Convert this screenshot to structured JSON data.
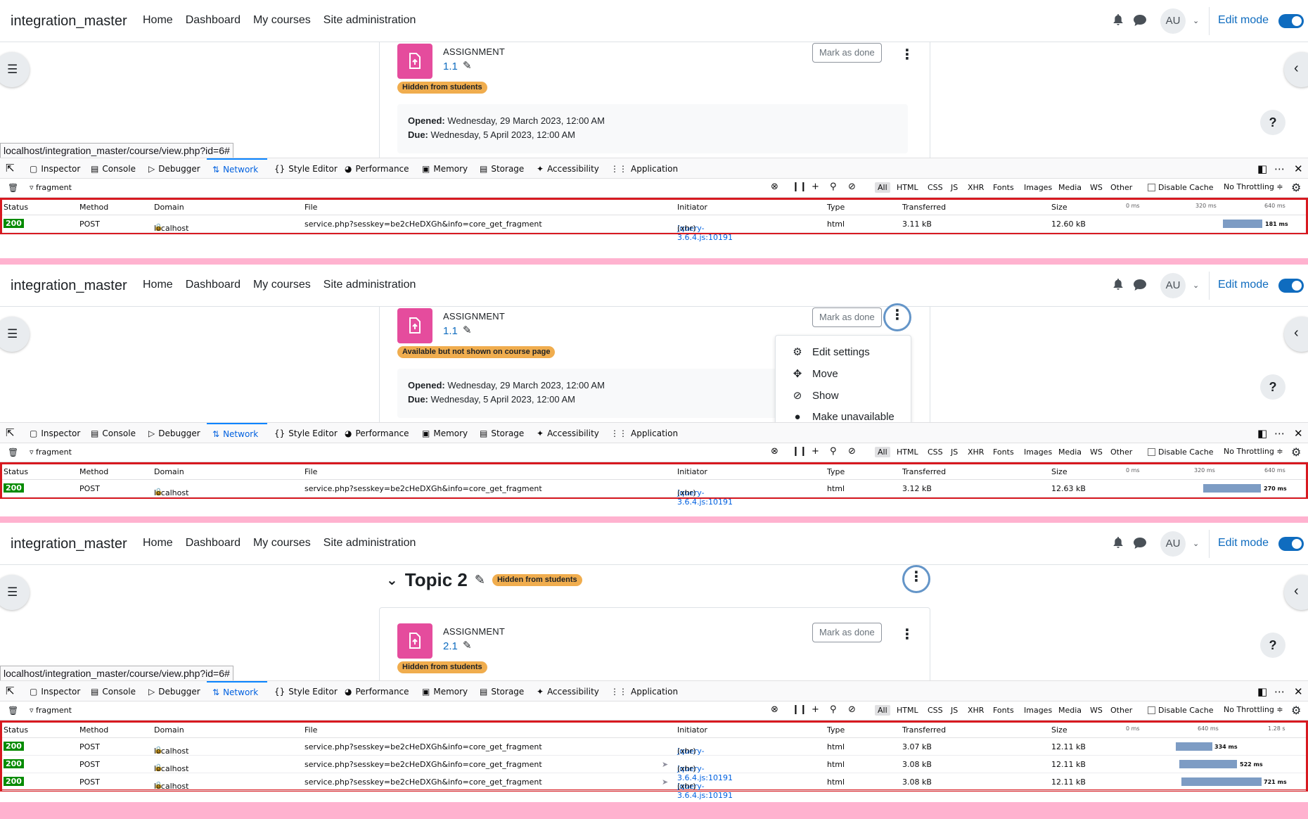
{
  "colors": {
    "accent": "#0f6cbf",
    "assignment_icon": "#e54c9d",
    "badge": "#f0ad4e",
    "status_ok": "#058b00",
    "highlight": "#d71920",
    "separator": "#ffb2cf"
  },
  "header": {
    "brand": "integration_master",
    "nav": [
      "Home",
      "Dashboard",
      "My courses",
      "Site administration"
    ],
    "avatar": "AU",
    "edit_mode": "Edit mode"
  },
  "assignment": {
    "type_label": "ASSIGNMENT",
    "mark_done": "Mark as done",
    "opened_label": "Opened:",
    "opened_value": " Wednesday, 29 March 2023, 12:00 AM",
    "due_label": "Due:",
    "due_value": " Wednesday, 5 April 2023, 12:00 AM"
  },
  "panels": [
    {
      "assignment_name": "1.1",
      "badge": "Hidden from students",
      "url": "localhost/integration_master/course/view.php?id=6#"
    },
    {
      "assignment_name": "1.1",
      "badge": "Available but not shown on course page",
      "menu": [
        {
          "icon": "gear-icon",
          "label": "Edit settings"
        },
        {
          "icon": "move-icon",
          "label": "Move"
        },
        {
          "icon": "eye-slash-icon",
          "label": "Show"
        },
        {
          "icon": "chat-icon",
          "label": "Make unavailable"
        }
      ]
    },
    {
      "topic": "Topic 2",
      "topic_badge": "Hidden from students",
      "assignment_name": "2.1",
      "badge": "Hidden from students",
      "url": "localhost/integration_master/course/view.php?id=6#"
    }
  ],
  "devtools": {
    "tabs": [
      "Inspector",
      "Console",
      "Debugger",
      "Network",
      "Style Editor",
      "Performance",
      "Memory",
      "Storage",
      "Accessibility",
      "Application"
    ],
    "filter": "fragment",
    "types": [
      "All",
      "HTML",
      "CSS",
      "JS",
      "XHR",
      "Fonts",
      "Images",
      "Media",
      "WS",
      "Other"
    ],
    "disable_cache": "Disable Cache",
    "throttling": "No Throttling ≑",
    "columns": [
      "Status",
      "Method",
      "Domain",
      "File",
      "Initiator",
      "Type",
      "Transferred",
      "Size"
    ]
  },
  "network": [
    {
      "ticks": [
        "0 ms",
        "320 ms",
        "640 ms"
      ],
      "rows": [
        {
          "status": "200",
          "method": "POST",
          "domain": "localhost",
          "file": "service.php?sesskey=be2cHeDXGh&info=core_get_fragment",
          "initiator": "jquery-3.6.4.js:10191",
          "initiator_suffix": " (xhr)",
          "type": "html",
          "transferred": "3.11 kB",
          "size": "12.60 kB",
          "time": "181 ms"
        }
      ]
    },
    {
      "ticks": [
        "0 ms",
        "320 ms",
        "640 ms"
      ],
      "rows": [
        {
          "status": "200",
          "method": "POST",
          "domain": "localhost",
          "file": "service.php?sesskey=be2cHeDXGh&info=core_get_fragment",
          "initiator": "jquery-3.6.4.js:10191",
          "initiator_suffix": " (xhr)",
          "type": "html",
          "transferred": "3.12 kB",
          "size": "12.63 kB",
          "time": "270 ms"
        }
      ]
    },
    {
      "ticks": [
        "0 ms",
        "640 ms",
        "1.28 s"
      ],
      "rows": [
        {
          "status": "200",
          "method": "POST",
          "domain": "localhost",
          "file": "service.php?sesskey=be2cHeDXGh&info=core_get_fragment",
          "initiator": "jquery-3.6.4.js:10191",
          "initiator_suffix": " (xhr)",
          "type": "html",
          "transferred": "3.07 kB",
          "size": "12.11 kB",
          "time": "334 ms"
        },
        {
          "status": "200",
          "method": "POST",
          "domain": "localhost",
          "file": "service.php?sesskey=be2cHeDXGh&info=core_get_fragment",
          "initiator": "jquery-3.6.4.js:10191",
          "initiator_suffix": " (xhr)",
          "type": "html",
          "transferred": "3.08 kB",
          "size": "12.11 kB",
          "time": "522 ms"
        },
        {
          "status": "200",
          "method": "POST",
          "domain": "localhost",
          "file": "service.php?sesskey=be2cHeDXGh&info=core_get_fragment",
          "initiator": "jquery-3.6.4.js:10191",
          "initiator_suffix": " (xhr)",
          "type": "html",
          "transferred": "3.08 kB",
          "size": "12.11 kB",
          "time": "721 ms"
        }
      ]
    }
  ]
}
